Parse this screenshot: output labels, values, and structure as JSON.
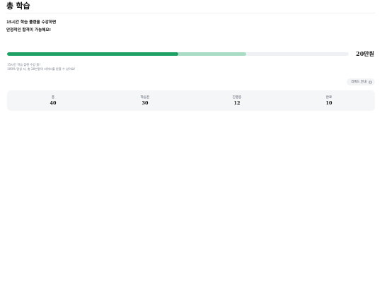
{
  "header": {
    "title": "총 학습"
  },
  "hero": {
    "line1": "15시간 학습 플랜을 수강하면",
    "line2": "안정적인 합격이 가능해요!"
  },
  "progress": {
    "primary_fraction": 0.5,
    "secondary_fraction": 0.7,
    "primary_color": "#1fa065",
    "secondary_color": "#a9dcc4",
    "track_color": "#eef0f3",
    "reward_amount": "20만원",
    "caption_line1": "15시간 학습 플랜 수강 중!",
    "caption_line2": "100% 달성 시, 총 20만원의 리워드를 받을 수 있어요!"
  },
  "reward_guide": {
    "label": "리워드 안내",
    "icon": "info-icon"
  },
  "stats": [
    {
      "label": "총",
      "value": "40"
    },
    {
      "label": "학습전",
      "value": "30"
    },
    {
      "label": "진행중",
      "value": "12"
    },
    {
      "label": "완료",
      "value": "10"
    }
  ]
}
